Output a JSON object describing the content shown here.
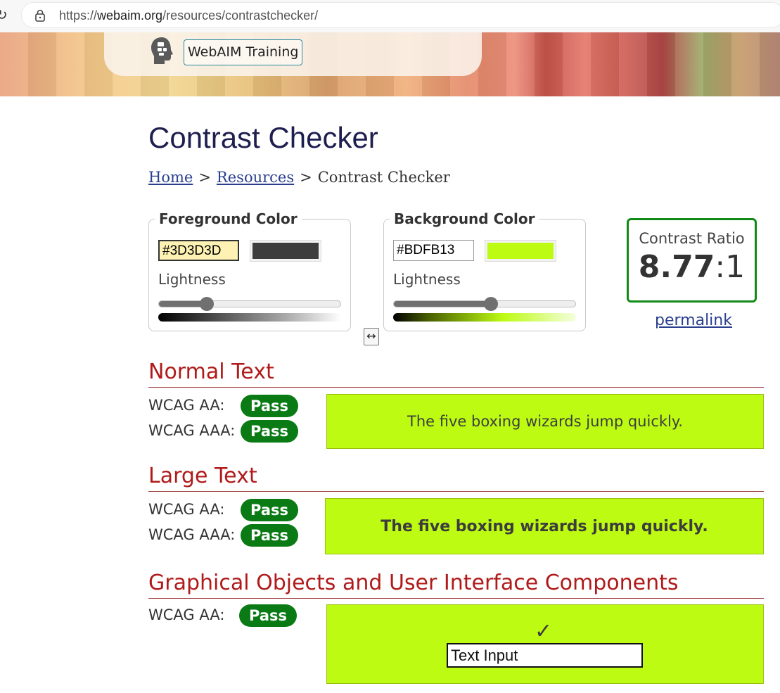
{
  "browser": {
    "url_prefix": "https://",
    "url_host": "webaim.org",
    "url_path": "/resources/contrastchecker/"
  },
  "nav": {
    "training_label": "WebAIM Training"
  },
  "page": {
    "title": "Contrast Checker",
    "breadcrumb": {
      "home": "Home",
      "resources": "Resources",
      "current": "Contrast Checker",
      "separator": ">"
    }
  },
  "foreground": {
    "legend": "Foreground Color",
    "hex": "#3D3D3D",
    "color": "#3d3d3d",
    "lightness_label": "Lightness",
    "lightness_fraction": 0.26
  },
  "background": {
    "legend": "Background Color",
    "hex": "#BDFB13",
    "color": "#bdfb13",
    "lightness_label": "Lightness",
    "lightness_fraction": 0.53
  },
  "swap": {
    "icon": "swap-icon",
    "glyph": "↔"
  },
  "contrast": {
    "label": "Contrast Ratio",
    "ratio_value": "8.77",
    "ratio_suffix": ":1",
    "permalink": "permalink"
  },
  "sections": {
    "normal": {
      "heading": "Normal Text",
      "aa_label": "WCAG AA:",
      "aa_result": "Pass",
      "aaa_label": "WCAG AAA:",
      "aaa_result": "Pass",
      "sample": "The five boxing wizards jump quickly."
    },
    "large": {
      "heading": "Large Text",
      "aa_label": "WCAG AA:",
      "aa_result": "Pass",
      "aaa_label": "WCAG AAA:",
      "aaa_result": "Pass",
      "sample": "The five boxing wizards jump quickly."
    },
    "graphical": {
      "heading": "Graphical Objects and User Interface Components",
      "aa_label": "WCAG AA:",
      "aa_result": "Pass",
      "check_glyph": "✓",
      "text_input_value": "Text Input"
    }
  },
  "colors": {
    "pass_green": "#0a7a14",
    "heading_red": "#b01a1a",
    "link_blue": "#2a3f8f"
  }
}
